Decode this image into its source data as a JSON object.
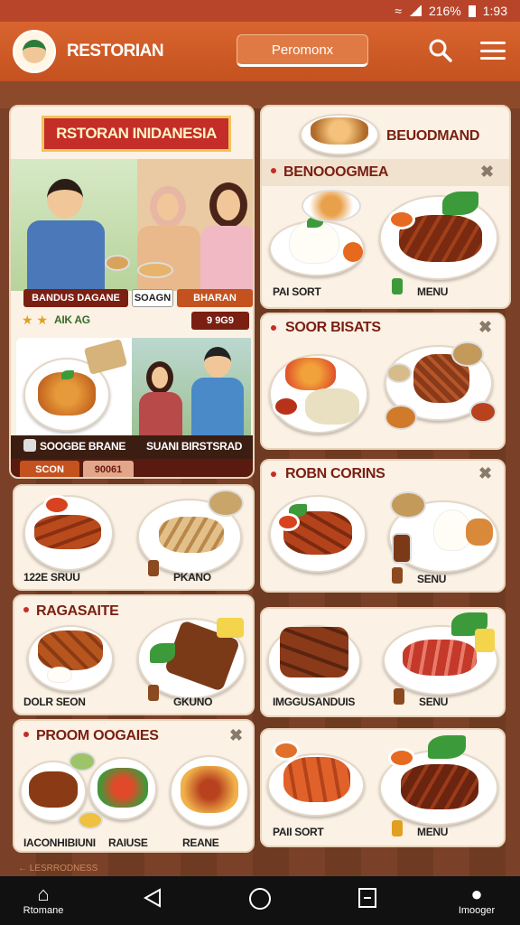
{
  "status": {
    "battery": "216%",
    "time": "1:93"
  },
  "app": {
    "title": "RESTORIAN",
    "search_value": "Peromonx"
  },
  "hero": {
    "banner": "RSTORAN INIDANESIA",
    "tag_left": "BANDUS DAGANE",
    "tag_mid": "SOAGN",
    "tag_right": "BHARAN",
    "rating_text": "AIK AG",
    "badge": "9 9G9",
    "label_left": "SOOGBE BRANE",
    "label_right": "SUANI BIRSTSRAD",
    "btn_left": "SCON",
    "btn_mid": "90061"
  },
  "left_cards": [
    {
      "title": "",
      "label_left": "122E SRUU",
      "label_right": "PKANO"
    },
    {
      "title": "RAGASAITE",
      "label_left": "DOLR SEON",
      "label_right": "GKUNO"
    },
    {
      "title": "PROOM OOGAIES",
      "label_left": "IACONHIBIUNI",
      "label_mid": "RAIUSE",
      "label_right": "REANE"
    }
  ],
  "right_cards": [
    {
      "title": "BEUODMAND",
      "section": "BENOOOGMEA",
      "label_left": "PAI SORT",
      "label_right": "MENU"
    },
    {
      "title": "SOOR BISATS"
    },
    {
      "title": "ROBN CORINS",
      "label_right": "SENU"
    },
    {
      "title": "",
      "label_left": "IMGGUSANDUIS",
      "label_right": "SENU"
    },
    {
      "title": "",
      "label_left": "PAII SORT",
      "label_right": "MENU"
    }
  ],
  "footer_hint": "← LESRRODNESS",
  "nav": {
    "home": "Rtomane",
    "profile": "Imooger"
  },
  "colors": {
    "brand": "#c4521f",
    "accent_red": "#7a1f12",
    "card_bg": "#fbf1e4"
  }
}
